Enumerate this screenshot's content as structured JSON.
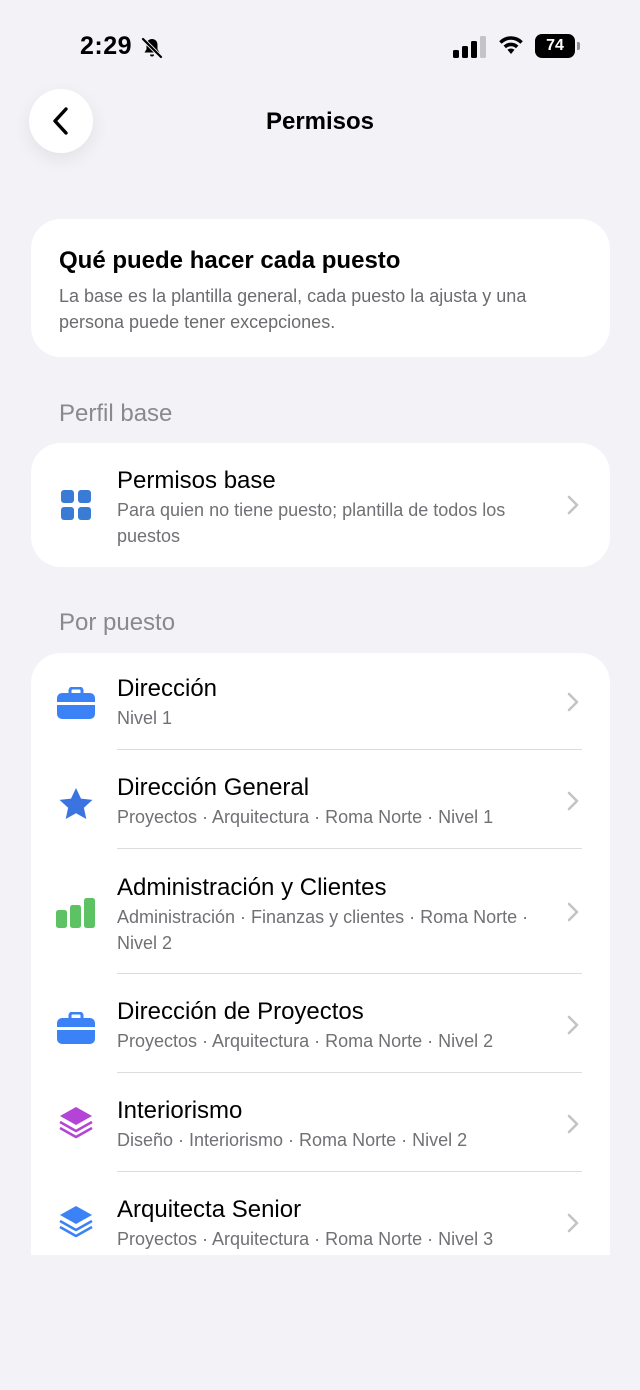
{
  "status": {
    "time": "2:29",
    "battery": "74"
  },
  "nav": {
    "title": "Permisos"
  },
  "intro": {
    "title": "Qué puede hacer cada puesto",
    "text": "La base es la plantilla general, cada puesto la ajusta y una persona puede tener excepciones."
  },
  "sections": {
    "base_label": "Perfil base",
    "by_role_label": "Por puesto"
  },
  "base_item": {
    "title": "Permisos base",
    "subtitle": "Para quien no tiene puesto; plantilla de todos los puestos",
    "icon": "grid-icon",
    "color": "#3a7bd5"
  },
  "roles": [
    {
      "title": "Dirección",
      "subtitle": "Nivel 1",
      "icon": "briefcase-icon",
      "color": "#3b82f6"
    },
    {
      "title": "Dirección General",
      "subtitle": "Proyectos · Arquitectura · Roma Norte · Nivel 1",
      "icon": "star-icon",
      "color": "#3b74e0"
    },
    {
      "title": "Administración y Clientes",
      "subtitle": "Administración · Finanzas y clientes · Roma Norte · Nivel 2",
      "icon": "bar-chart-icon",
      "color": "#5dc264"
    },
    {
      "title": "Dirección de Proyectos",
      "subtitle": "Proyectos · Arquitectura · Roma Norte · Nivel 2",
      "icon": "briefcase-icon",
      "color": "#3b82f6"
    },
    {
      "title": "Interiorismo",
      "subtitle": "Diseño · Interiorismo · Roma Norte · Nivel 2",
      "icon": "layers-icon",
      "color": "#b444d8"
    },
    {
      "title": "Arquitecta Senior",
      "subtitle": "Proyectos · Arquitectura · Roma Norte · Nivel 3",
      "icon": "layers-icon",
      "color": "#3b82f6"
    }
  ]
}
